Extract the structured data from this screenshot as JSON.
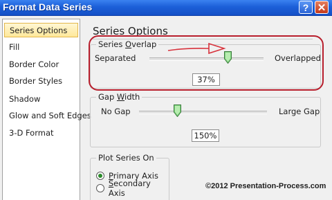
{
  "window": {
    "title": "Format Data Series",
    "help_label": "?",
    "close_label": "✕"
  },
  "sidebar": {
    "items": [
      {
        "label": "Series Options",
        "selected": true
      },
      {
        "label": "Fill",
        "selected": false
      },
      {
        "label": "Border Color",
        "selected": false
      },
      {
        "label": "Border Styles",
        "selected": false
      },
      {
        "label": "Shadow",
        "selected": false
      },
      {
        "label": "Glow and Soft Edges",
        "selected": false
      },
      {
        "label": "3-D Format",
        "selected": false
      }
    ]
  },
  "panel": {
    "title": "Series Options",
    "series_overlap": {
      "label_pre": "Series ",
      "label_accel": "O",
      "label_post": "verlap",
      "left_label": "Separated",
      "right_label": "Overlapped",
      "value": "37%",
      "level_percent": 37
    },
    "gap_width": {
      "label_pre": "Gap ",
      "label_accel": "W",
      "label_post": "idth",
      "left_label": "No Gap",
      "right_label": "Large Gap",
      "value": "150%",
      "level_fraction": 0.3
    },
    "plot_series_on": {
      "label": "Plot Series On",
      "options": [
        {
          "accel": "P",
          "rest": "rimary Axis",
          "checked": true
        },
        {
          "accel": "S",
          "rest": "econdary Axis",
          "checked": false
        }
      ]
    }
  },
  "annotation": {
    "highlight_color": "#b81e2c",
    "arrow_color": "#d8323c",
    "copyright": "©2012 Presentation-Process.com"
  }
}
